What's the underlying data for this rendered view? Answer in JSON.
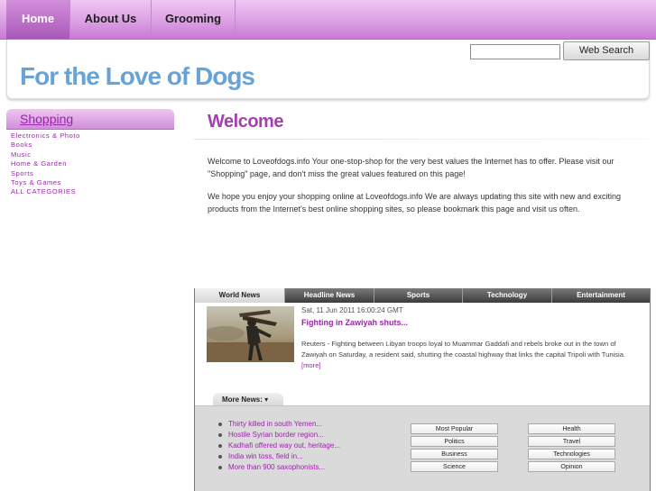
{
  "nav": {
    "items": [
      {
        "label": "Home",
        "active": true
      },
      {
        "label": "About Us",
        "active": false
      },
      {
        "label": "Grooming",
        "active": false
      }
    ]
  },
  "search": {
    "value": "",
    "placeholder": "",
    "button_label": "Web Search"
  },
  "site": {
    "title": "For the Love of Dogs"
  },
  "sidebar": {
    "heading": "Shopping",
    "categories": [
      "Electronics & Photo",
      "Books",
      "Music",
      "Home & Garden",
      "Sports",
      "Toys & Games",
      "ALL CATEGORIES"
    ]
  },
  "main": {
    "heading": "Welcome",
    "paragraphs": [
      "Welcome to Loveofdogs.info Your one-stop-shop for the very best values the Internet has to offer. Please visit our \"Shopping\" page, and don't miss the great values featured on this page!",
      "We hope you enjoy your shopping online at Loveofdogs.info We are always updating this site with new and exciting products from the Internet's best online shopping sites, so please bookmark this page and visit us often."
    ]
  },
  "news": {
    "tabs": [
      {
        "label": "World News",
        "active": true
      },
      {
        "label": "Headline News",
        "active": false
      },
      {
        "label": "Sports",
        "active": false
      },
      {
        "label": "Technology",
        "active": false
      },
      {
        "label": "Entertainment",
        "active": false
      }
    ],
    "feature": {
      "date": "Sat, 11 Jun 2011 16:00:24 GMT",
      "title": "Fighting in Zawiyah shuts...",
      "body": "Reuters - Fighting between Libyan troops loyal to Muammar Gaddafi and rebels broke out in the town of Zawiyah on Saturday, a resident said, shutting the coastal highway that links the capital Tripoli with Tunisia.",
      "more_link": "[more]"
    },
    "more_news_label": "More News: ▾",
    "more_news": [
      "Thirty killed in south Yemen...",
      "Hostile Syrian border region...",
      "Kadhafi offered way out, heritage...",
      "India win toss, field in...",
      "More than 900 saxophonists..."
    ],
    "category_buttons": [
      [
        "Most Popular",
        "Health"
      ],
      [
        "Politics",
        "Travel"
      ],
      [
        "Business",
        "Technologies"
      ],
      [
        "Science",
        "Opinion"
      ]
    ]
  },
  "colors": {
    "accent_purple": "#9a26a9",
    "nav_pink": "#dca0e4",
    "title_blue": "#68a3d8",
    "tab_dark": "#3c3c3c"
  }
}
